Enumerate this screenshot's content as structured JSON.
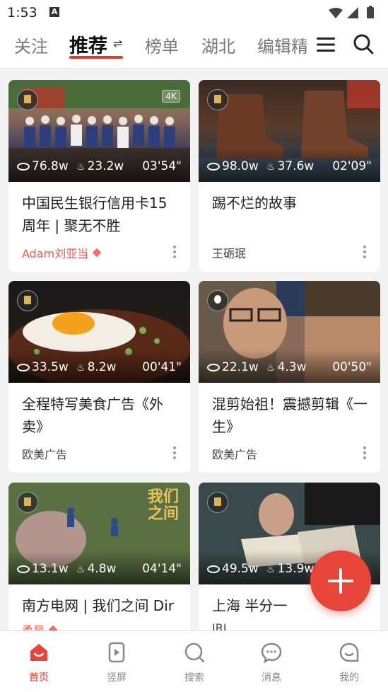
{
  "status": {
    "time": "1:53",
    "notification_icon": "A"
  },
  "nav": {
    "tabs": [
      "关注",
      "推荐",
      "榜单",
      "湖北",
      "编辑精"
    ],
    "active": "推荐",
    "swap_symbol": "⇌"
  },
  "cards": [
    {
      "title": "中国民生银行信用卡15周年 | 聚无不胜",
      "author": "Adam刘亚当",
      "author_highlight": true,
      "views": "76.8w",
      "likes": "23.2w",
      "duration": "03'54\"",
      "quality": "4K",
      "badge": "crown"
    },
    {
      "title": "踢不烂的故事",
      "author": "王砺珉",
      "author_highlight": false,
      "views": "98.0w",
      "likes": "37.6w",
      "duration": "02'09\"",
      "quality": "",
      "badge": "crown"
    },
    {
      "title": "全程特写美食广告《外卖》",
      "author": "欧美广告",
      "author_highlight": false,
      "views": "33.5w",
      "likes": "8.2w",
      "duration": "00'41\"",
      "quality": "",
      "badge": "crown"
    },
    {
      "title": "混剪始祖！震撼剪辑《一生》",
      "author": "欧美广告",
      "author_highlight": false,
      "views": "22.1w",
      "likes": "4.3w",
      "duration": "00'50\"",
      "quality": "",
      "badge": "bulb"
    },
    {
      "title": "南方电网 | 我们之间 Dir",
      "author": "柔是",
      "author_highlight": true,
      "views": "13.1w",
      "likes": "4.8w",
      "duration": "04'14\"",
      "quality": "",
      "badge": "crown",
      "thumb_text": "我们之间"
    },
    {
      "title": "上海 半分一",
      "author": "JRL",
      "author_highlight": false,
      "views": "49.5w",
      "likes": "13.9w",
      "duration": "",
      "quality": "",
      "badge": "crown"
    }
  ],
  "bottom_nav": [
    {
      "label": "首页",
      "icon": "home-icon",
      "active": true
    },
    {
      "label": "竖屏",
      "icon": "vertical-play-icon",
      "active": false
    },
    {
      "label": "搜索",
      "icon": "search-icon",
      "active": false
    },
    {
      "label": "消息",
      "icon": "message-icon",
      "active": false
    },
    {
      "label": "我的",
      "icon": "profile-icon",
      "active": false
    }
  ],
  "colors": {
    "accent": "#e0392e",
    "fab": "#e8453a",
    "author_highlight": "#e35a4a"
  }
}
